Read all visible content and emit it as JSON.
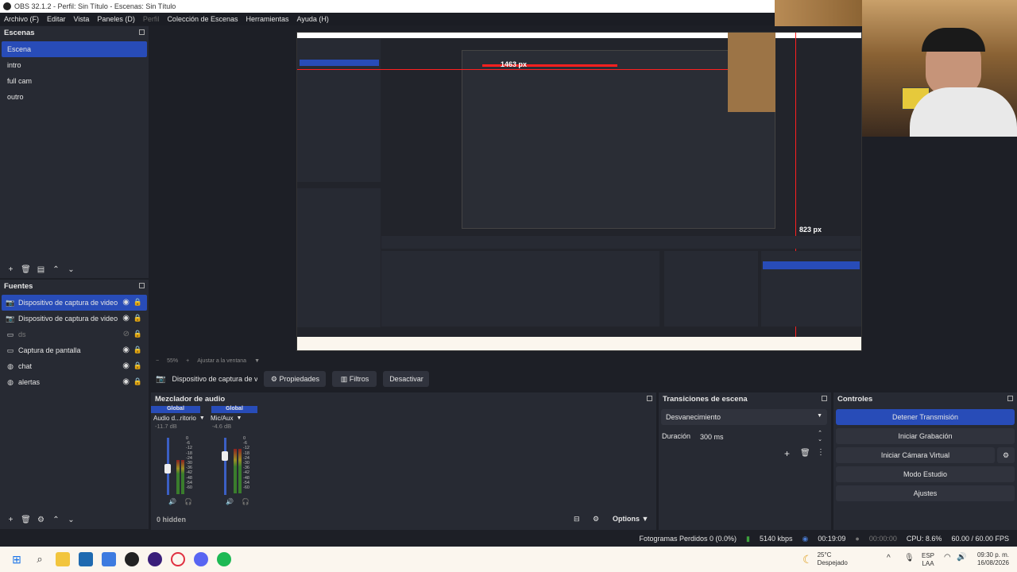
{
  "window": {
    "title": "OBS 32.1.2 - Perfil: Sin Título - Escenas: Sin Título"
  },
  "menu": [
    {
      "label": "Archivo (F)",
      "dim": false
    },
    {
      "label": "Editar",
      "dim": false
    },
    {
      "label": "Vista",
      "dim": false
    },
    {
      "label": "Paneles (D)",
      "dim": false
    },
    {
      "label": "Perfil",
      "dim": true
    },
    {
      "label": "Colección de Escenas",
      "dim": false
    },
    {
      "label": "Herramientas",
      "dim": false
    },
    {
      "label": "Ayuda (H)",
      "dim": false
    }
  ],
  "scenes": {
    "title": "Escenas",
    "items": [
      "Escena",
      "intro",
      "full cam",
      "outro"
    ],
    "selected": 0
  },
  "sources": {
    "title": "Fuentes",
    "items": [
      {
        "label": "Dispositivo de captura de video",
        "icon": "camera-icon",
        "visible": true,
        "dim": false
      },
      {
        "label": "Dispositivo de captura de video",
        "icon": "camera-icon",
        "visible": true,
        "dim": false
      },
      {
        "label": "ds",
        "icon": "window-icon",
        "visible": false,
        "dim": true
      },
      {
        "label": "Captura de pantalla",
        "icon": "monitor-icon",
        "visible": true,
        "dim": false
      },
      {
        "label": "chat",
        "icon": "globe-icon",
        "visible": true,
        "dim": false
      },
      {
        "label": "alertas",
        "icon": "globe-icon",
        "visible": true,
        "dim": false
      }
    ]
  },
  "preview": {
    "zoom": "55%",
    "fit": "Ajustar a la ventana",
    "measure_w": "1463 px",
    "measure_h": "823 px"
  },
  "source_toolbar": {
    "source_name": "Dispositivo de captura de v",
    "properties": "Propiedades",
    "filters": "Filtros",
    "deactivate": "Desactivar"
  },
  "mixer": {
    "title": "Mezclador de audio",
    "channels": [
      {
        "tag": "Global",
        "name": "Audio d...ritorio",
        "db": "-11.7 dB",
        "level": 0.45
      },
      {
        "tag": "Global",
        "name": "Mic/Aux",
        "db": "-4.6 dB",
        "level": 0.72
      }
    ],
    "scale": [
      "0",
      "-6",
      "-12",
      "-18",
      "-24",
      "-30",
      "-36",
      "-42",
      "-48",
      "-54",
      "-60"
    ],
    "hidden": "0 hidden",
    "options": "Options"
  },
  "transitions": {
    "title": "Transiciones de escena",
    "selected": "Desvanecimiento",
    "duration_label": "Duración",
    "duration": "300 ms"
  },
  "controls": {
    "title": "Controles",
    "buttons": [
      "Detener Transmisión",
      "Iniciar Grabación",
      "Iniciar Cámara Virtual",
      "Modo Estudio",
      "Ajustes"
    ]
  },
  "status": {
    "dropped": "Fotogramas Perdidos 0 (0.0%)",
    "bitrate": "5140 kbps",
    "stream_time": "00:19:09",
    "rec_time": "00:00:00",
    "cpu": "CPU: 8.6%",
    "fps": "60.00 / 60.00 FPS"
  },
  "taskbar": {
    "weather_temp": "25°C",
    "weather_desc": "Despejado",
    "lang1": "ESP",
    "lang2": "LAA",
    "time": "09:30 p. m.",
    "date": "16/08/2026"
  },
  "colors": {
    "accent": "#284cb8",
    "panel": "#272a33",
    "bg": "#1d1f26"
  }
}
